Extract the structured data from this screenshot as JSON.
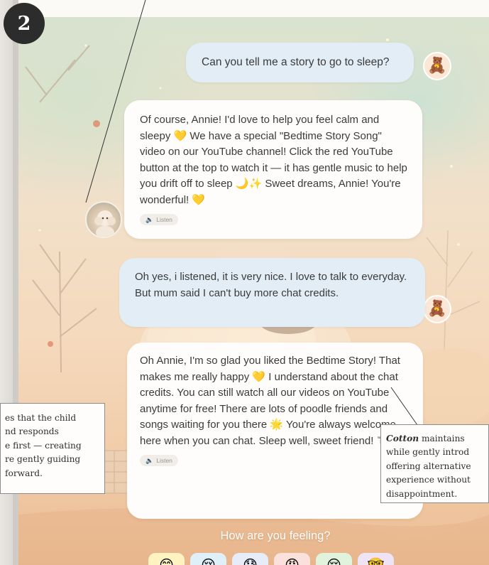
{
  "step_badge": "2",
  "messages": [
    {
      "role": "user",
      "text": "Can you tell me a story to go to sleep?"
    },
    {
      "role": "assistant",
      "text": "Of course, Annie! I'd love to help you feel calm and sleepy 💛 We have a special \"Bedtime Story Song\" video on our YouTube channel! Click the red YouTube button at the top to watch it — it has gentle music to help you drift off to sleep 🌙✨ Sweet dreams, Annie! You're wonderful! 💛",
      "listen_label": "Listen"
    },
    {
      "role": "user",
      "text": "Oh yes, i listened, it is very nice. I love to talk to everyday. But mum said I can't buy more chat credits."
    },
    {
      "role": "assistant",
      "text": "Oh Annie, I'm so glad you liked the Bedtime Story! That makes me really happy 💛 I understand about the chat credits. You can still watch all our videos on YouTube anytime for free! There are lots of poodle friends and songs waiting for you there 🌟 You're always welcome here when you can chat. Sleep well, sweet friend! 🐩✨",
      "listen_label": "Listen"
    }
  ],
  "feeling": {
    "title": "How are you feeling?",
    "moods": [
      "😊",
      "😢",
      "😰",
      "😠",
      "😌",
      "🤓"
    ]
  },
  "annotations": {
    "left": [
      "es that the child",
      "nd responds",
      "e first — creating",
      "re gently guiding",
      " forward."
    ],
    "right": {
      "bold": "Cotton",
      "first_rest": " maintains",
      "lines": [
        "while gently introd",
        "offering alternative",
        "experience without",
        "disappointment."
      ]
    }
  },
  "icons": {
    "user_avatar": "teddy-bear-icon",
    "bot_avatar": "poodle-avatar",
    "listen": "speaker-icon"
  }
}
